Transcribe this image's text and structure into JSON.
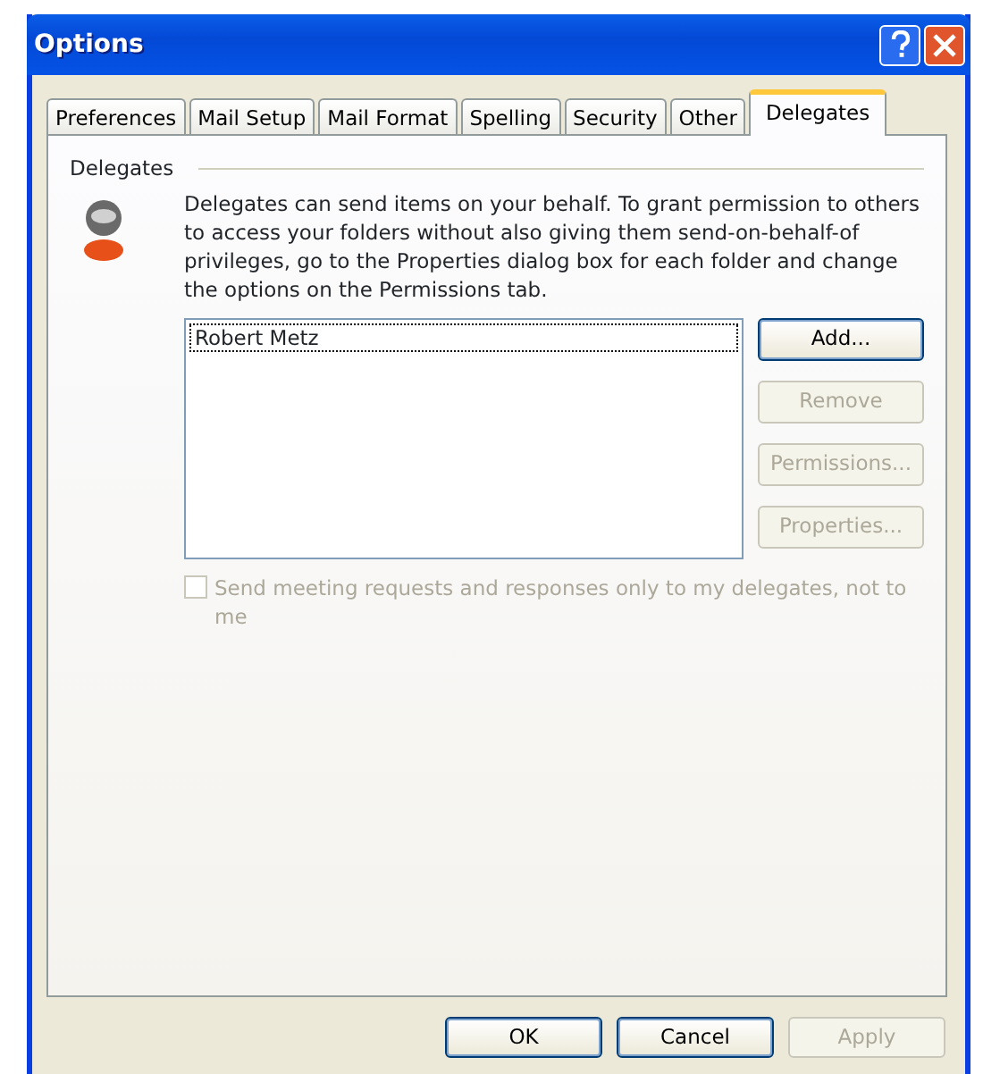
{
  "window": {
    "title": "Options"
  },
  "tabs": [
    {
      "label": "Preferences",
      "selected": false
    },
    {
      "label": "Mail Setup",
      "selected": false
    },
    {
      "label": "Mail Format",
      "selected": false
    },
    {
      "label": "Spelling",
      "selected": false
    },
    {
      "label": "Security",
      "selected": false
    },
    {
      "label": "Other",
      "selected": false
    },
    {
      "label": "Delegates",
      "selected": true
    }
  ],
  "group": {
    "label": "Delegates",
    "description": "Delegates can send items on your behalf. To grant permission to others to access your folders without also giving them send-on-behalf-of privileges, go to the Properties dialog box for each folder and change the options on the Permissions tab."
  },
  "delegates": [
    {
      "name": "Robert Metz",
      "selected": true
    }
  ],
  "side_buttons": [
    {
      "label": "Add...",
      "disabled": false
    },
    {
      "label": "Remove",
      "disabled": true
    },
    {
      "label": "Permissions...",
      "disabled": true
    },
    {
      "label": "Properties...",
      "disabled": true
    }
  ],
  "checkbox": {
    "label": "Send meeting requests and responses only to my delegates, not to me",
    "checked": false,
    "disabled": true
  },
  "buttons": [
    {
      "label": "OK",
      "disabled": false
    },
    {
      "label": "Cancel",
      "disabled": false
    },
    {
      "label": "Apply",
      "disabled": true
    }
  ]
}
